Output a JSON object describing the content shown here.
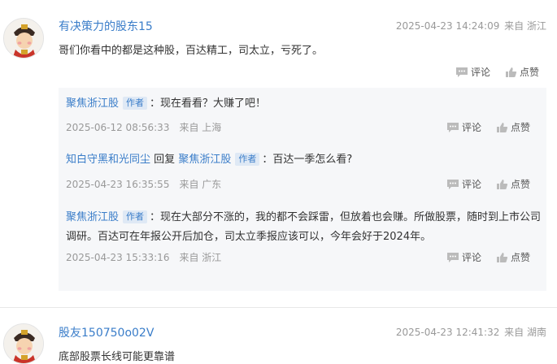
{
  "comments": [
    {
      "username": "有决策力的股东15",
      "timestamp": "2025-04-23 14:24:09",
      "location": "来自 浙江",
      "text": "哥们你看中的都是这种股，百达精工，司太立，亏死了。",
      "comment_label": "评论",
      "like_label": "点赞",
      "replies": [
        {
          "author": "聚焦浙江股",
          "author_badge": "作者",
          "text": "：现在看看？大赚了吧！",
          "timestamp": "2025-06-12 08:56:33",
          "location": "来自 上海",
          "comment_label": "评论",
          "like_label": "点赞"
        },
        {
          "author": "知白守黑和光同尘",
          "reply_word": "回复",
          "reply_to": "聚焦浙江股",
          "reply_to_badge": "作者",
          "text": "：百达一季怎么看?",
          "timestamp": "2025-04-23 16:35:55",
          "location": "来自 广东",
          "comment_label": "评论",
          "like_label": "点赞"
        },
        {
          "author": "聚焦浙江股",
          "author_badge": "作者",
          "text": "：现在大部分不涨的，我的都不会踩雷，但放着也会赚。所做股票，随时到上市公司调研。百达可在年报公开后加仓，司太立季报应该可以，今年会好于2024年。",
          "timestamp": "2025-04-23 15:33:16",
          "location": "来自 浙江",
          "comment_label": "评论",
          "like_label": "点赞"
        }
      ]
    },
    {
      "username": "股友150750o02V",
      "timestamp": "2025-04-23 12:41:32",
      "location": "来自 湖南",
      "text": "底部股票长线可能更靠谱"
    }
  ],
  "icons": {
    "comment": "comment-bubble-icon",
    "like": "thumbs-up-icon",
    "avatar": "fortune-god-avatar"
  },
  "colors": {
    "link": "#3a7dc9",
    "meta": "#999999",
    "reply_bg": "#f6f7f9"
  }
}
